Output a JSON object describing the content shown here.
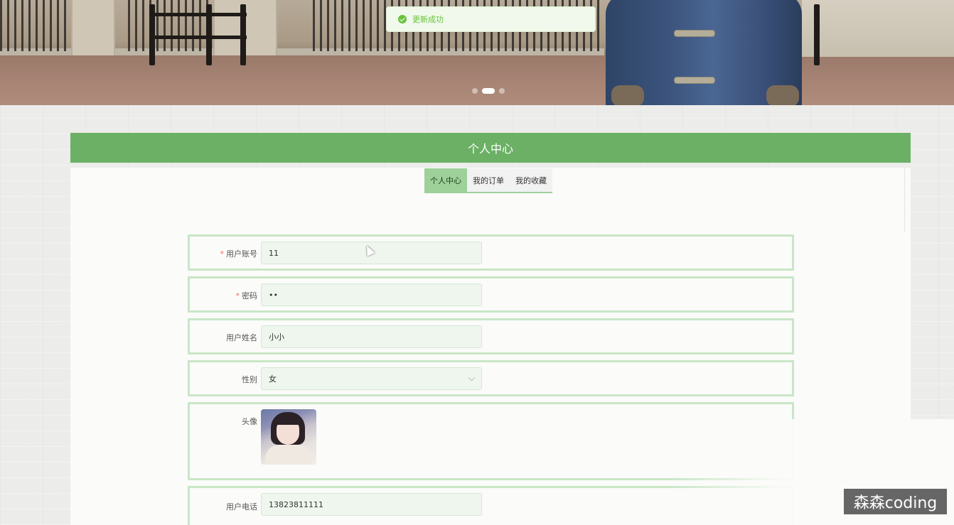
{
  "toast": {
    "message": "更新成功",
    "icon": "check-circle-icon",
    "color": "#67c23a"
  },
  "banner": {
    "carousel_count": 3,
    "active_index": 1
  },
  "header": {
    "title": "个人中心",
    "accent": "#6bb065"
  },
  "tabs": [
    {
      "label": "个人中心",
      "active": true
    },
    {
      "label": "我的订单",
      "active": false
    },
    {
      "label": "我的收藏",
      "active": false
    }
  ],
  "form": {
    "username": {
      "label": "用户账号",
      "required": true,
      "value": "11"
    },
    "password": {
      "label": "密码",
      "required": true,
      "value": "••"
    },
    "name": {
      "label": "用户姓名",
      "required": false,
      "value": "小小"
    },
    "gender": {
      "label": "性别",
      "required": false,
      "value": "女"
    },
    "avatar": {
      "label": "头像"
    },
    "phone": {
      "label": "用户电话",
      "required": false,
      "value": "13823811111"
    }
  },
  "watermark": "森森coding"
}
